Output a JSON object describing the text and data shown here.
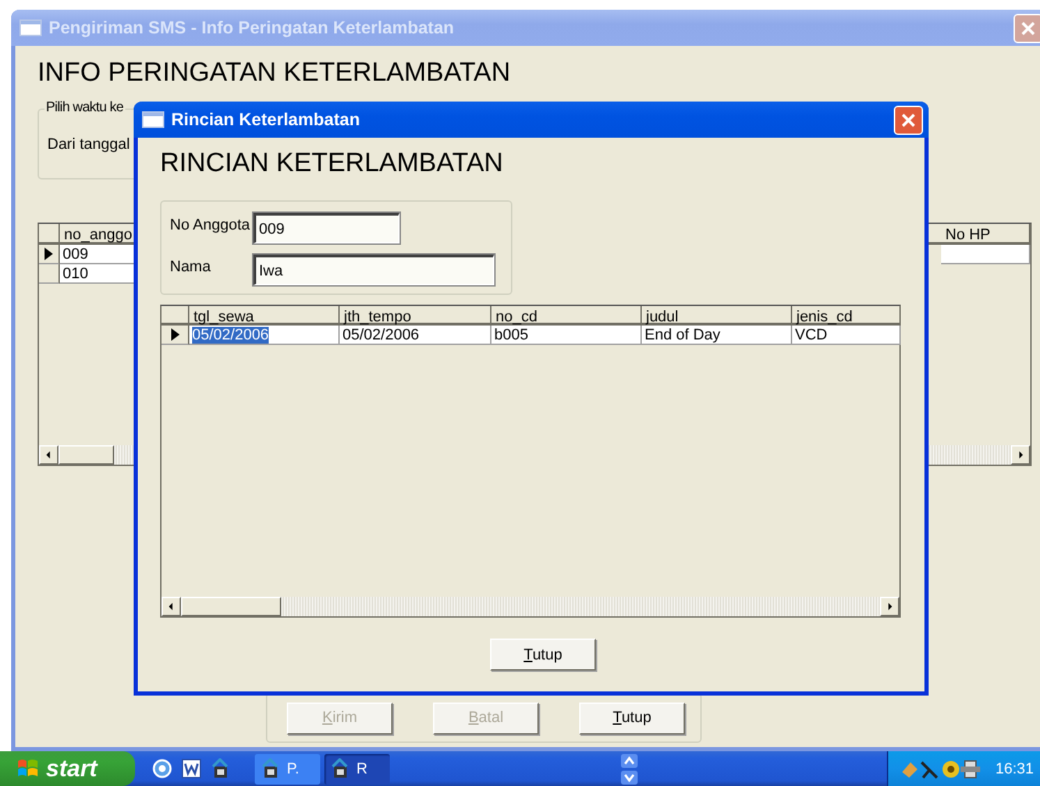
{
  "main_window": {
    "title": "Pengiriman SMS - Info Peringatan Keterlambatan",
    "active": false,
    "heading": "INFO PERINGATAN KETERLAMBATAN",
    "date_group": {
      "label": "Pilih waktu ke",
      "from_label": "Dari tanggal"
    },
    "grid": {
      "columns": [
        "no_anggo",
        "No HP"
      ],
      "rows": [
        {
          "cells": [
            "009"
          ],
          "current": true
        },
        {
          "cells": [
            "010"
          ],
          "current": false
        }
      ]
    },
    "buttons": [
      {
        "label": "Kirim",
        "disabled": true
      },
      {
        "label": "Batal",
        "disabled": true
      },
      {
        "label": "Tutup",
        "disabled": false
      }
    ]
  },
  "dialog": {
    "title": "Rincian Keterlambatan",
    "active": true,
    "heading": "RINCIAN KETERLAMBATAN",
    "fields": [
      {
        "label": "No Anggota",
        "value": "009"
      },
      {
        "label": "Nama",
        "value": "Iwa"
      }
    ],
    "grid": {
      "columns": [
        "tgl_sewa",
        "jth_tempo",
        "no_cd",
        "judul",
        "jenis_cd"
      ],
      "rows": [
        {
          "current": true,
          "cells": [
            {
              "text": "05/02/2006",
              "selected": true
            },
            {
              "text": "05/02/2006",
              "selected": false
            },
            {
              "text": "b005",
              "selected": false
            },
            {
              "text": "End of Day",
              "selected": false
            },
            {
              "text": "VCD",
              "selected": false
            }
          ]
        }
      ]
    },
    "buttons": [
      {
        "label": "Tutup",
        "disabled": false
      }
    ]
  },
  "taskbar": {
    "start": "start",
    "tasks": [
      {
        "label": "P.",
        "selected": false
      },
      {
        "label": "R",
        "selected": true
      }
    ],
    "clock": "16:31"
  }
}
